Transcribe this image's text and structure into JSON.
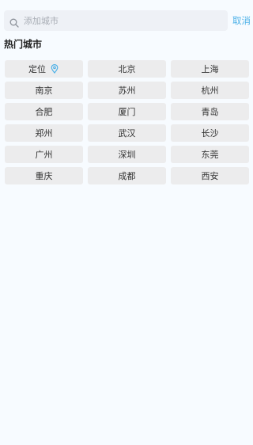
{
  "search": {
    "placeholder": "添加城市",
    "cancel_label": "取消"
  },
  "hot_cities": {
    "title": "热门城市",
    "locate_label": "定位",
    "cities": [
      "北京",
      "上海",
      "南京",
      "苏州",
      "杭州",
      "合肥",
      "厦门",
      "青岛",
      "郑州",
      "武汉",
      "长沙",
      "广州",
      "深圳",
      "东莞",
      "重庆",
      "成都",
      "西安"
    ]
  },
  "colors": {
    "accent": "#4db1e8",
    "background": "#f7fbff",
    "chip": "#ececed"
  }
}
